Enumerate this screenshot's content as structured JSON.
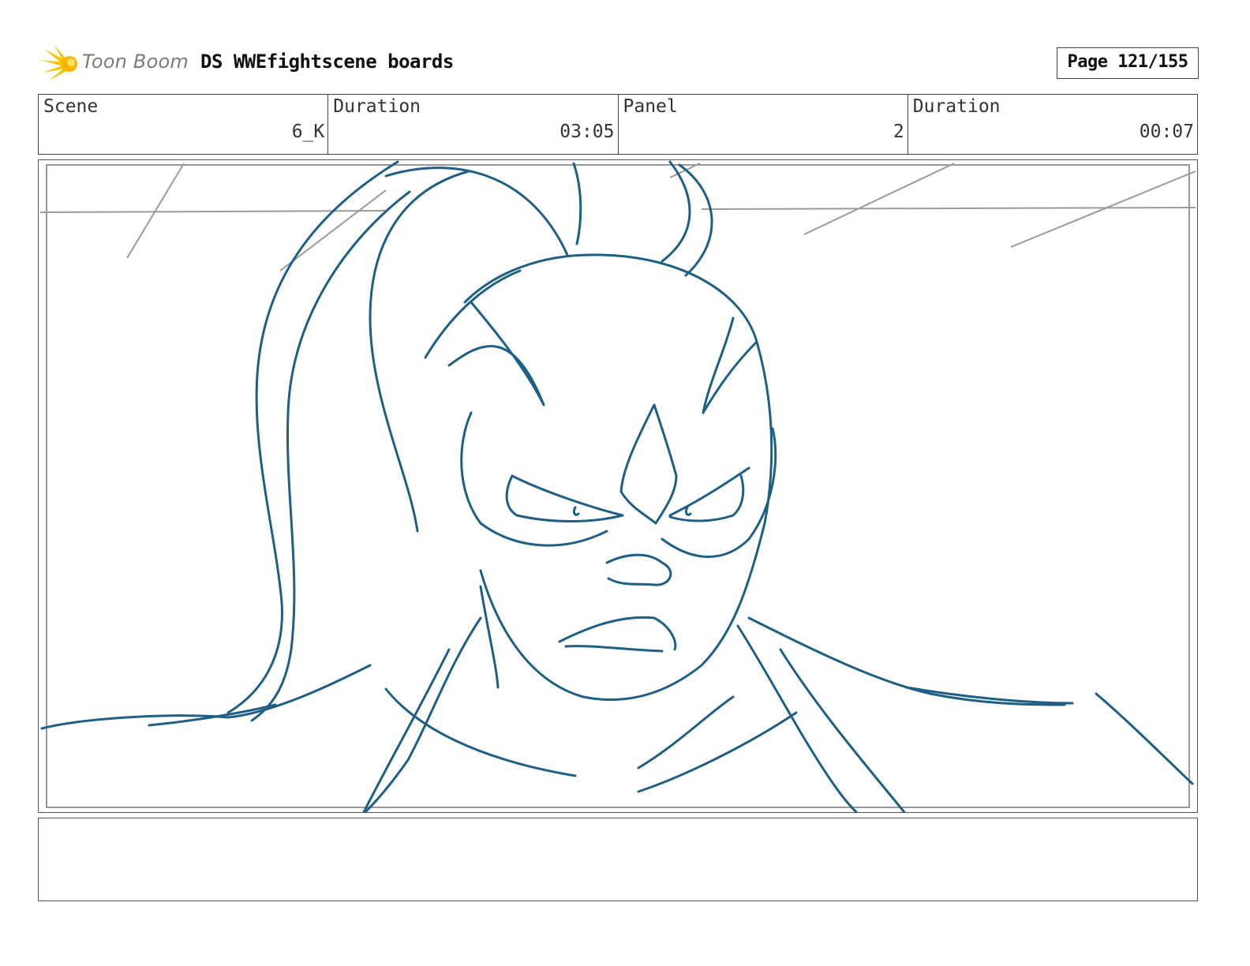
{
  "header": {
    "logo_text": "Toon Boom",
    "document_title": "DS WWEfightscene boards",
    "page_label": "Page 121/155"
  },
  "info": [
    {
      "label": "Scene",
      "value": "6_K"
    },
    {
      "label": "Duration",
      "value": "03:05"
    },
    {
      "label": "Panel",
      "value": "2"
    },
    {
      "label": "Duration",
      "value": "00:07"
    }
  ],
  "panel": {
    "sketch_color": "#1e5f86",
    "guide_color": "#9a9a9a"
  },
  "notes": {
    "text": ""
  }
}
